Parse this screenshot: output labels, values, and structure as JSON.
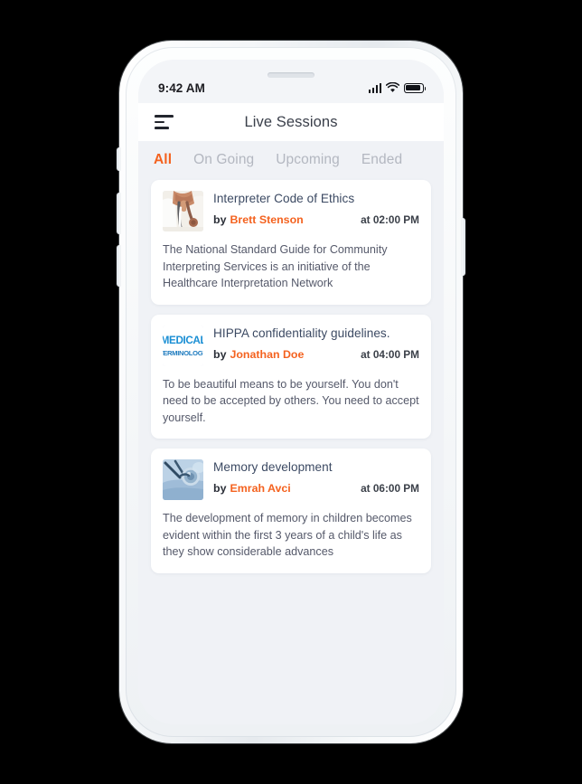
{
  "device": {
    "speaker_name": "earpiece-speaker"
  },
  "status_bar": {
    "time": "9:42 AM",
    "signal_icon": "signal-bars-icon",
    "wifi_icon": "wifi-icon",
    "battery_icon": "battery-icon"
  },
  "nav": {
    "menu_icon": "hamburger-menu-icon",
    "title": "Live Sessions"
  },
  "tabs": [
    {
      "label": "All",
      "active": true
    },
    {
      "label": "On Going",
      "active": false
    },
    {
      "label": "Upcoming",
      "active": false
    },
    {
      "label": "Ended",
      "active": false
    }
  ],
  "by_label": "by",
  "sessions": [
    {
      "title": "Interpreter Code of Ethics",
      "author": "Brett Stenson",
      "time": "at 02:00 PM",
      "description": "The National Standard Guide for Community Interpreting Services is an initiative of the Healthcare Interpretation Network",
      "thumbnail": "doctor-stethoscope-photo"
    },
    {
      "title": "HIPPA confidentiality guidelines.",
      "author": "Jonathan Doe",
      "time": "at 04:00 PM",
      "description": "To be beautiful means to be yourself. You don't need to be accepted by others. You need to accept yourself.",
      "thumbnail": "medical-terminology-logo",
      "thumbnail_text_top": "MEDICAL",
      "thumbnail_text_bottom": "TERMINOLOGY"
    },
    {
      "title": "Memory development",
      "author": "Emrah Avci",
      "time": "at 06:00 PM",
      "description": "The development of memory in children becomes evident within the first 3 years of a child's life as they show considerable advances",
      "thumbnail": "blue-stethoscope-photo"
    }
  ],
  "colors": {
    "accent_orange": "#f4621f",
    "title_blue": "#3c4a63",
    "tab_inactive": "#b3b7c0",
    "screen_bg": "#f0f2f6",
    "card_bg": "#ffffff",
    "page_bg": "#000000"
  }
}
